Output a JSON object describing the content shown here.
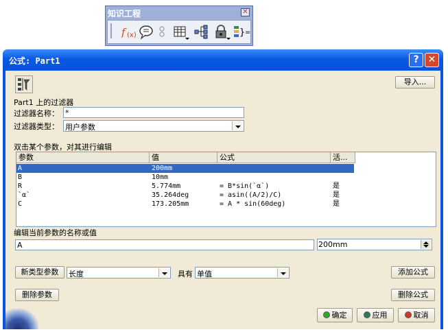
{
  "toolbar": {
    "title": "知识工程",
    "close_glyph": "✕",
    "icons": [
      "formula-fx-icon",
      "comment-bubble-icon",
      "rule-chain-icon",
      "table-icon",
      "hierarchy-icon",
      "lock-icon",
      "equations-icon"
    ]
  },
  "dialog": {
    "title": "公式:  Part1",
    "help_glyph": "?",
    "close_glyph": "✕",
    "import_button": "导入...",
    "filter_heading": "Part1 上的过滤器",
    "filter_name_label": "过滤器名称：",
    "filter_name_value": "*",
    "filter_type_label": "过滤器类型：",
    "filter_type_value": "用户参数",
    "table_caption": "双击某个参数，对其进行编辑",
    "columns": [
      "参数",
      "值",
      "公式",
      "活..."
    ],
    "rows": [
      {
        "param": "A",
        "value": "200mm",
        "formula": "",
        "active": "",
        "selected": true
      },
      {
        "param": "B",
        "value": "10mm",
        "formula": "",
        "active": "",
        "selected": false
      },
      {
        "param": "R",
        "value": "5.774mm",
        "formula": "= B*sin(`α`)",
        "active": "是",
        "selected": false
      },
      {
        "param": "`α`",
        "value": "35.264deg",
        "formula": "= asin((A/2)/C)",
        "active": "是",
        "selected": false
      },
      {
        "param": "C",
        "value": "173.205mm",
        "formula": "= A * sin(60deg)",
        "active": "是",
        "selected": false
      }
    ],
    "edit_label": "编辑当前参数的名称或值",
    "edit_name_value": "A",
    "edit_value": "200mm",
    "new_param_button": "新类型参数",
    "param_type_value": "长度",
    "with_label": "具有",
    "value_kind": "单值",
    "add_formula_button": "添加公式",
    "delete_param_button": "删除参数",
    "delete_formula_button": "删除公式",
    "ok_button": "确定",
    "apply_button": "应用",
    "cancel_button": "取消",
    "colors": {
      "ok": "#2ea82e",
      "apply": "#2f7a55",
      "cancel": "#d03a2a",
      "selection": "#316ac5"
    }
  }
}
